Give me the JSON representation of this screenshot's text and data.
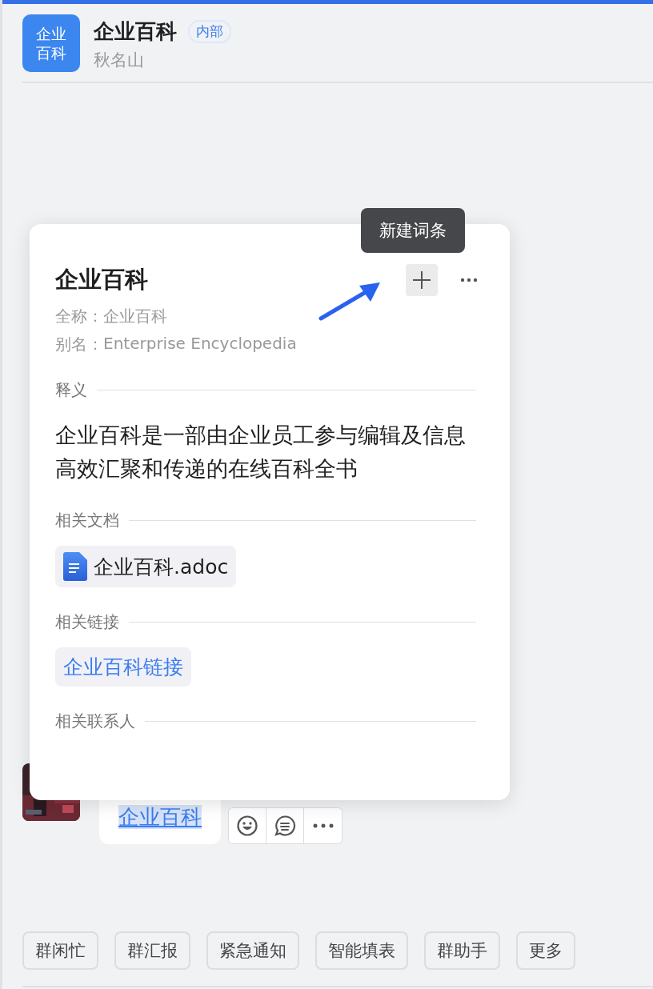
{
  "header": {
    "logo_lines": [
      "企业",
      "百科"
    ],
    "title": "企业百科",
    "tag": "内部",
    "subtitle": "秋名山"
  },
  "message": {
    "text": "企业百科",
    "highlighted": true
  },
  "quick_actions": [
    "群闲忙",
    "群汇报",
    "紧急通知",
    "智能填表",
    "群助手",
    "更多"
  ],
  "card": {
    "title": "企业百科",
    "tooltip": "新建词条",
    "fields": [
      {
        "label": "全称：",
        "value": "企业百科"
      },
      {
        "label": "别名：",
        "value": "Enterprise Encyclopedia"
      }
    ],
    "sections": [
      {
        "kind": "text",
        "heading": "释义",
        "text": "企业百科是一部由企业员工参与编辑及信息高效汇聚和传递的在线百科全书"
      },
      {
        "kind": "doc",
        "heading": "相关文档",
        "name": "企业百科.adoc"
      },
      {
        "kind": "link",
        "heading": "相关链接",
        "text": "企业百科链接"
      },
      {
        "kind": "contacts",
        "heading": "相关联系人"
      }
    ]
  }
}
